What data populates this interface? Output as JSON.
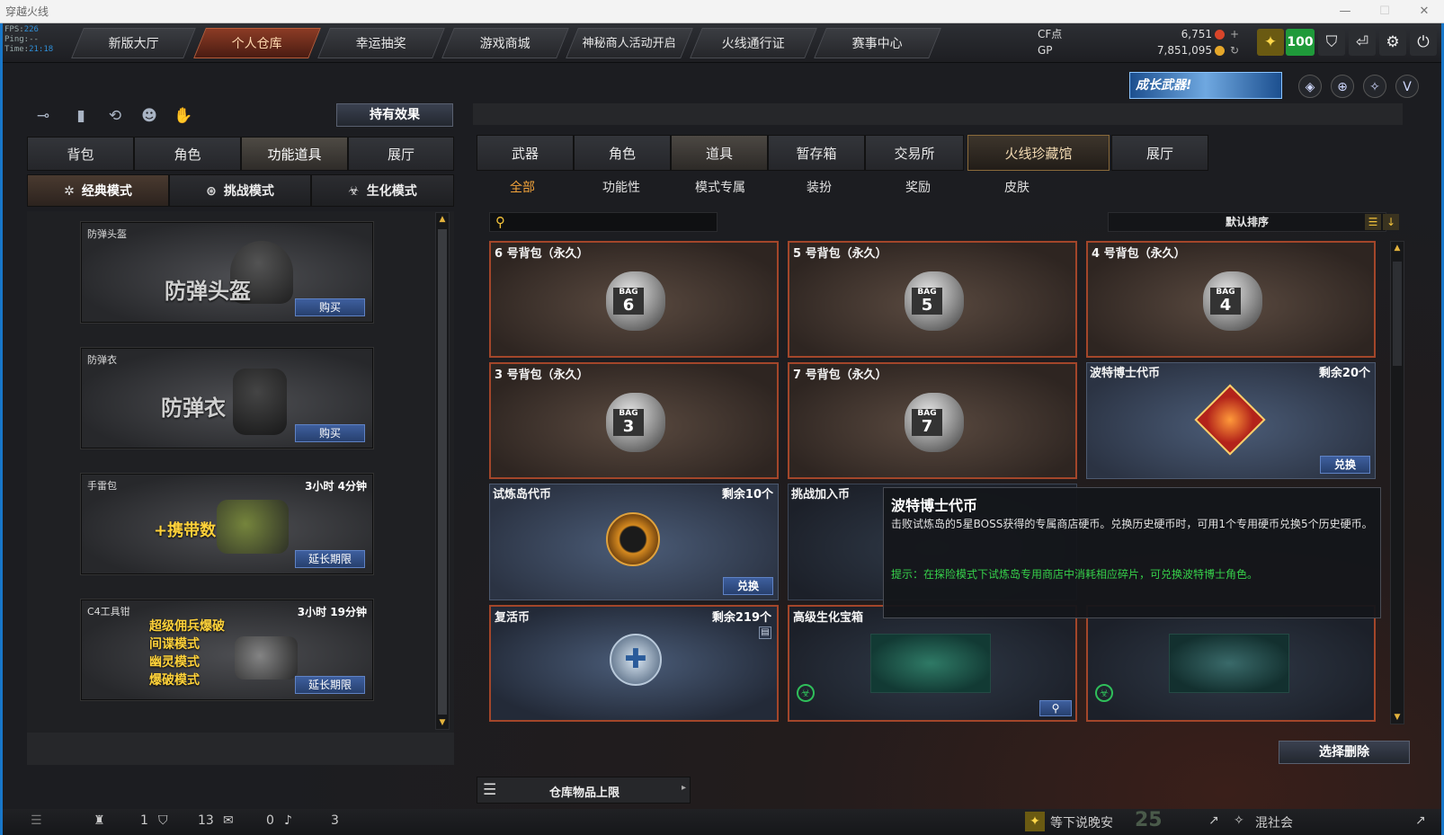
{
  "window": {
    "title": "穿越火线",
    "minimize": "—",
    "maximize": "☐",
    "close": "✕"
  },
  "stats": {
    "fps_label": "FPS:",
    "fps": "226",
    "ping_label": "Ping:",
    "ping": "--",
    "time_label": "Time:",
    "time": "21:18"
  },
  "nav": {
    "tabs": [
      {
        "label": "新版大厅"
      },
      {
        "label": "个人仓库"
      },
      {
        "label": "幸运抽奖"
      },
      {
        "label": "游戏商城"
      },
      {
        "label": "神秘商人活动开启"
      },
      {
        "label": "火线通行证"
      },
      {
        "label": "赛事中心"
      }
    ],
    "active": "个人仓库"
  },
  "currency": {
    "cf_label": "CF点",
    "cf_value": "6,751",
    "gp_label": "GP",
    "gp_value": "7,851,095"
  },
  "level": "100",
  "banner_text": "成长武器!",
  "left": {
    "holding_effects": "持有效果",
    "tabs": [
      {
        "label": "背包"
      },
      {
        "label": "角色"
      },
      {
        "label": "功能道具"
      },
      {
        "label": "展厅"
      }
    ],
    "modes": [
      {
        "label": "经典模式"
      },
      {
        "label": "挑战模式"
      },
      {
        "label": "生化模式"
      }
    ],
    "cards": [
      {
        "name": "防弹头盔",
        "big": "防弹头盔",
        "time": "",
        "button": "购买"
      },
      {
        "name": "防弹衣",
        "big": "防弹衣",
        "time": "",
        "button": "购买"
      },
      {
        "name": "手雷包",
        "big": "+携带数",
        "time": "3小时 4分钟",
        "button": "延长期限"
      },
      {
        "name": "C4工具钳",
        "big": "",
        "time": "3小时 19分钟",
        "button": "延长期限",
        "lines": [
          "超级佣兵爆破",
          "间谍模式",
          "幽灵模式",
          "爆破模式"
        ]
      }
    ]
  },
  "right": {
    "tabs": [
      {
        "label": "武器"
      },
      {
        "label": "角色"
      },
      {
        "label": "道具"
      },
      {
        "label": "暂存箱"
      },
      {
        "label": "交易所"
      },
      {
        "label": "火线珍藏馆"
      },
      {
        "label": "展厅"
      }
    ],
    "subtabs": [
      {
        "label": "全部"
      },
      {
        "label": "功能性"
      },
      {
        "label": "模式专属"
      },
      {
        "label": "装扮"
      },
      {
        "label": "奖励"
      },
      {
        "label": "皮肤"
      }
    ],
    "search_placeholder": "",
    "sort_label": "默认排序",
    "items": [
      {
        "name": "6 号背包（永久）",
        "bag": "6"
      },
      {
        "name": "5 号背包（永久）",
        "bag": "5"
      },
      {
        "name": "4 号背包（永久）",
        "bag": "4"
      },
      {
        "name": "3 号背包（永久）",
        "bag": "3"
      },
      {
        "name": "7 号背包（永久）",
        "bag": "7"
      },
      {
        "name": "波特博士代币",
        "remain": "剩余20个",
        "button": "兑换"
      },
      {
        "name": "试炼岛代币",
        "remain": "剩余10个",
        "button": "兑换"
      },
      {
        "name": "挑战加入币"
      },
      {
        "name": "复活币",
        "remain": "剩余219个"
      },
      {
        "name": "高级生化宝箱"
      },
      {
        "name": ""
      }
    ],
    "tooltip": {
      "title": "波特博士代币",
      "desc": "击败试炼岛的5星BOSS获得的专属商店硬币。兑换历史硬币时，可用1个专用硬币兑换5个历史硬币。",
      "hint": "提示：在探险模式下试炼岛专用商店中消耗相应碎片，可兑换波特博士角色。"
    },
    "delete_button": "选择删除",
    "storage_label": "仓库物品上限"
  },
  "bottom": {
    "friends": "1",
    "clan": "13",
    "messages": "0",
    "volume": "3",
    "player1": "等下说晚安",
    "player1_level": "25",
    "player2": "混社会"
  },
  "colors": {
    "accent": "#f0a23a",
    "border_item": "#a3462a",
    "frame": "#1877c9",
    "level_bg": "#1f9a3a"
  }
}
